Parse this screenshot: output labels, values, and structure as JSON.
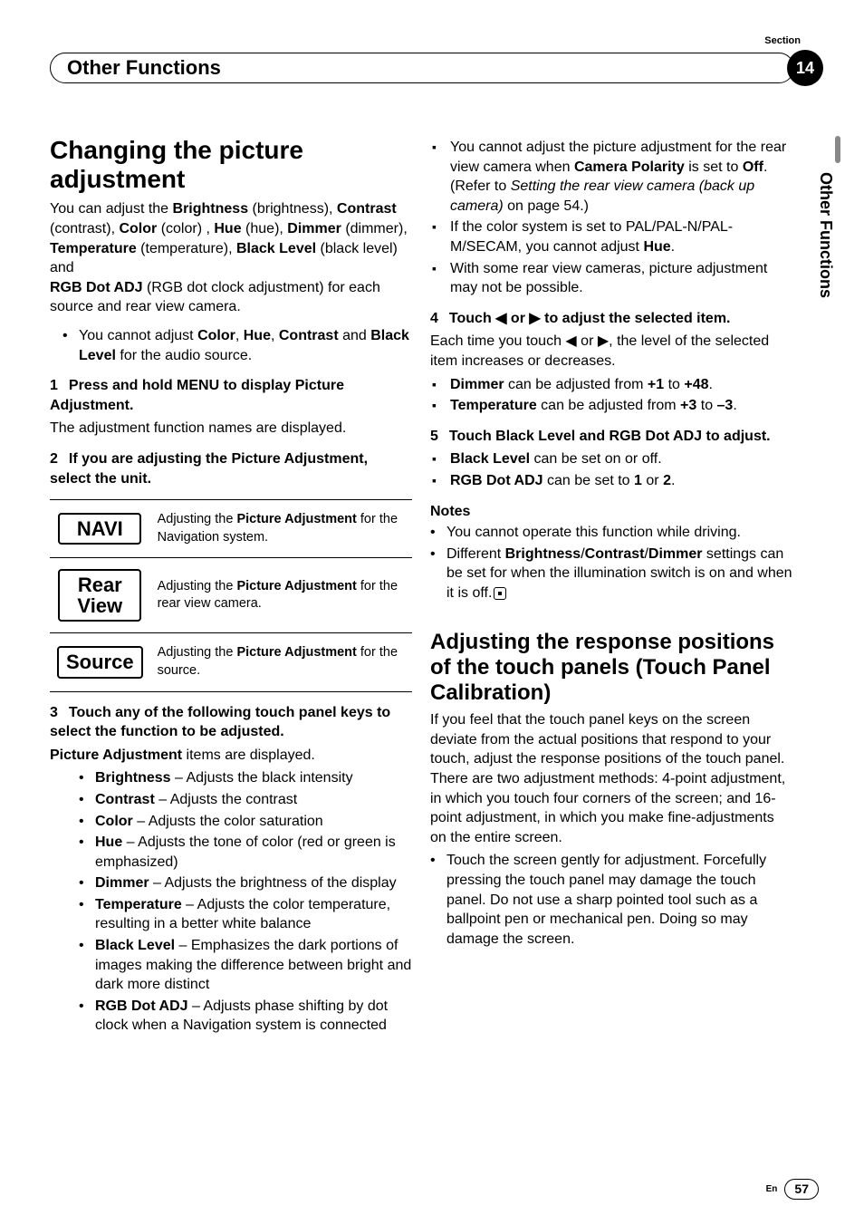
{
  "header": {
    "section_label": "Section",
    "title": "Other Functions",
    "page_badge": "14",
    "sidebar": "Other Functions"
  },
  "left": {
    "h1": "Changing the picture adjustment",
    "intro_parts": {
      "p1a": "You can adjust the ",
      "b_bright": "Brightness",
      "p1b": " (brightness), ",
      "b_contrast": "Contrast",
      "p1c": " (contrast), ",
      "b_color": "Color",
      "p1d": " (color) , ",
      "b_hue": "Hue",
      "p1e": " (hue), ",
      "b_dimmer": "Dimmer",
      "p1f": " (dimmer), ",
      "b_temp": "Temperature",
      "p1g": " (tempera­ture), ",
      "b_black": "Black Level",
      "p1h": " (black level) and ",
      "b_rgb": "RGB Dot ADJ",
      "p1i": " (RGB dot clock adjustment) for each source and rear view camera."
    },
    "bullet1": {
      "a": "You cannot adjust ",
      "b1": "Color",
      "b2": "Hue",
      "b3": "Contrast",
      "mid": " and ",
      "b4": "Black Level",
      "end": " for the audio source."
    },
    "step1": {
      "num": "1",
      "title": "Press and hold MENU to display Picture Adjustment.",
      "after": "The adjustment function names are displayed."
    },
    "step2": {
      "num": "2",
      "title": "If you are adjusting the Picture Adjustment, select the unit."
    },
    "table": [
      {
        "btn": "NAVI",
        "desc_a": "Adjusting the ",
        "desc_b": "Picture Adjustment",
        "desc_c": " for the Navigation system."
      },
      {
        "btn": "Rear View",
        "desc_a": "Adjusting the ",
        "desc_b": "Picture Adjustment",
        "desc_c": " for the rear view camera."
      },
      {
        "btn": "Source",
        "desc_a": "Adjusting the ",
        "desc_b": "Picture Adjustment",
        "desc_c": " for the source."
      }
    ],
    "step3": {
      "num": "3",
      "title": "Touch any of the following touch panel keys to select the function to be adjusted.",
      "after_a": "Picture Adjustment",
      "after_b": " items are displayed."
    },
    "functions": [
      {
        "name": "Brightness",
        "desc": " – Adjusts the black intensity"
      },
      {
        "name": "Contrast",
        "desc": " – Adjusts the contrast"
      },
      {
        "name": "Color",
        "desc": " – Adjusts the color saturation"
      },
      {
        "name": "Hue",
        "desc": " – Adjusts the tone of color (red or green is emphasized)"
      },
      {
        "name": "Dimmer",
        "desc": " – Adjusts the brightness of the dis­play"
      },
      {
        "name": "Temperature",
        "desc": " – Adjusts the color tempera­ture, resulting in a better white balance"
      },
      {
        "name": "Black Level",
        "desc": " – Emphasizes the dark portions of images making the difference between bright and dark more distinct"
      },
      {
        "name": "RGB Dot ADJ",
        "desc": " – Adjusts phase shifting by dot clock when a Navigation system is con­nected"
      }
    ]
  },
  "right": {
    "top_bullets": {
      "i1a": "You cannot adjust the picture adjustment for the rear view camera when ",
      "i1b": "Camera Polarity",
      "i1c": " is set to ",
      "i1d": "Off",
      "i1e": ". (Refer to ",
      "i1f": "Setting the rear view camera (back up camera)",
      "i1g": " on page 54.)",
      "i2a": "If the color system is set to PAL/PAL-N/PAL-M/SECAM, you cannot adjust ",
      "i2b": "Hue",
      "i2c": ".",
      "i3": "With some rear view cameras, picture adjust­ment may not be possible."
    },
    "step4": {
      "num": "4",
      "title_a": "Touch ",
      "title_b": " or ",
      "title_c": " to adjust the selected item.",
      "after_a": "Each time you touch ",
      "after_b": " or ",
      "after_c": ", the level of the selected item increases or decreases."
    },
    "step4_bullets": {
      "b1a": "Dimmer",
      "b1b": " can be adjusted from ",
      "b1c": "+1",
      "b1d": " to ",
      "b1e": "+48",
      "b1f": ".",
      "b2a": "Temperature",
      "b2b": " can be adjusted from ",
      "b2c": "+3",
      "b2d": " to ",
      "b2e": "–3",
      "b2f": "."
    },
    "step5": {
      "num": "5",
      "title": "Touch Black Level and RGB Dot ADJ to adjust."
    },
    "step5_bullets": {
      "b1a": "Black Level",
      "b1b": " can be set on or off.",
      "b2a": "RGB Dot ADJ",
      "b2b": " can be set to ",
      "b2c": "1",
      "b2d": " or ",
      "b2e": "2",
      "b2f": "."
    },
    "notes_head": "Notes",
    "notes": {
      "n1": "You cannot operate this function while driving.",
      "n2a": "Different ",
      "n2b": "Brightness",
      "n2c": "Contrast",
      "n2d": "Dimmer",
      "n2e": " set­tings can be set for when the illumination switch is on and when it is off."
    },
    "h2": "Adjusting the response positions of the touch panels (Touch Panel Calibration)",
    "cal_intro": "If you feel that the touch panel keys on the screen deviate from the actual positions that respond to your touch, adjust the response po­sitions of the touch panel. There are two ad­justment methods: 4-point adjustment, in which you touch four corners of the screen; and 16-point adjustment, in which you make fine-adjustments on the entire screen.",
    "cal_bullet": "Touch the screen gently for adjustment. Forcefully pressing the touch panel may da­mage the touch panel. Do not use a sharp pointed tool such as a ballpoint pen or me­chanical pen. Doing so may damage the screen."
  },
  "footer": {
    "lang": "En",
    "page": "57"
  },
  "glyphs": {
    "left": "◀",
    "right": "▶"
  }
}
